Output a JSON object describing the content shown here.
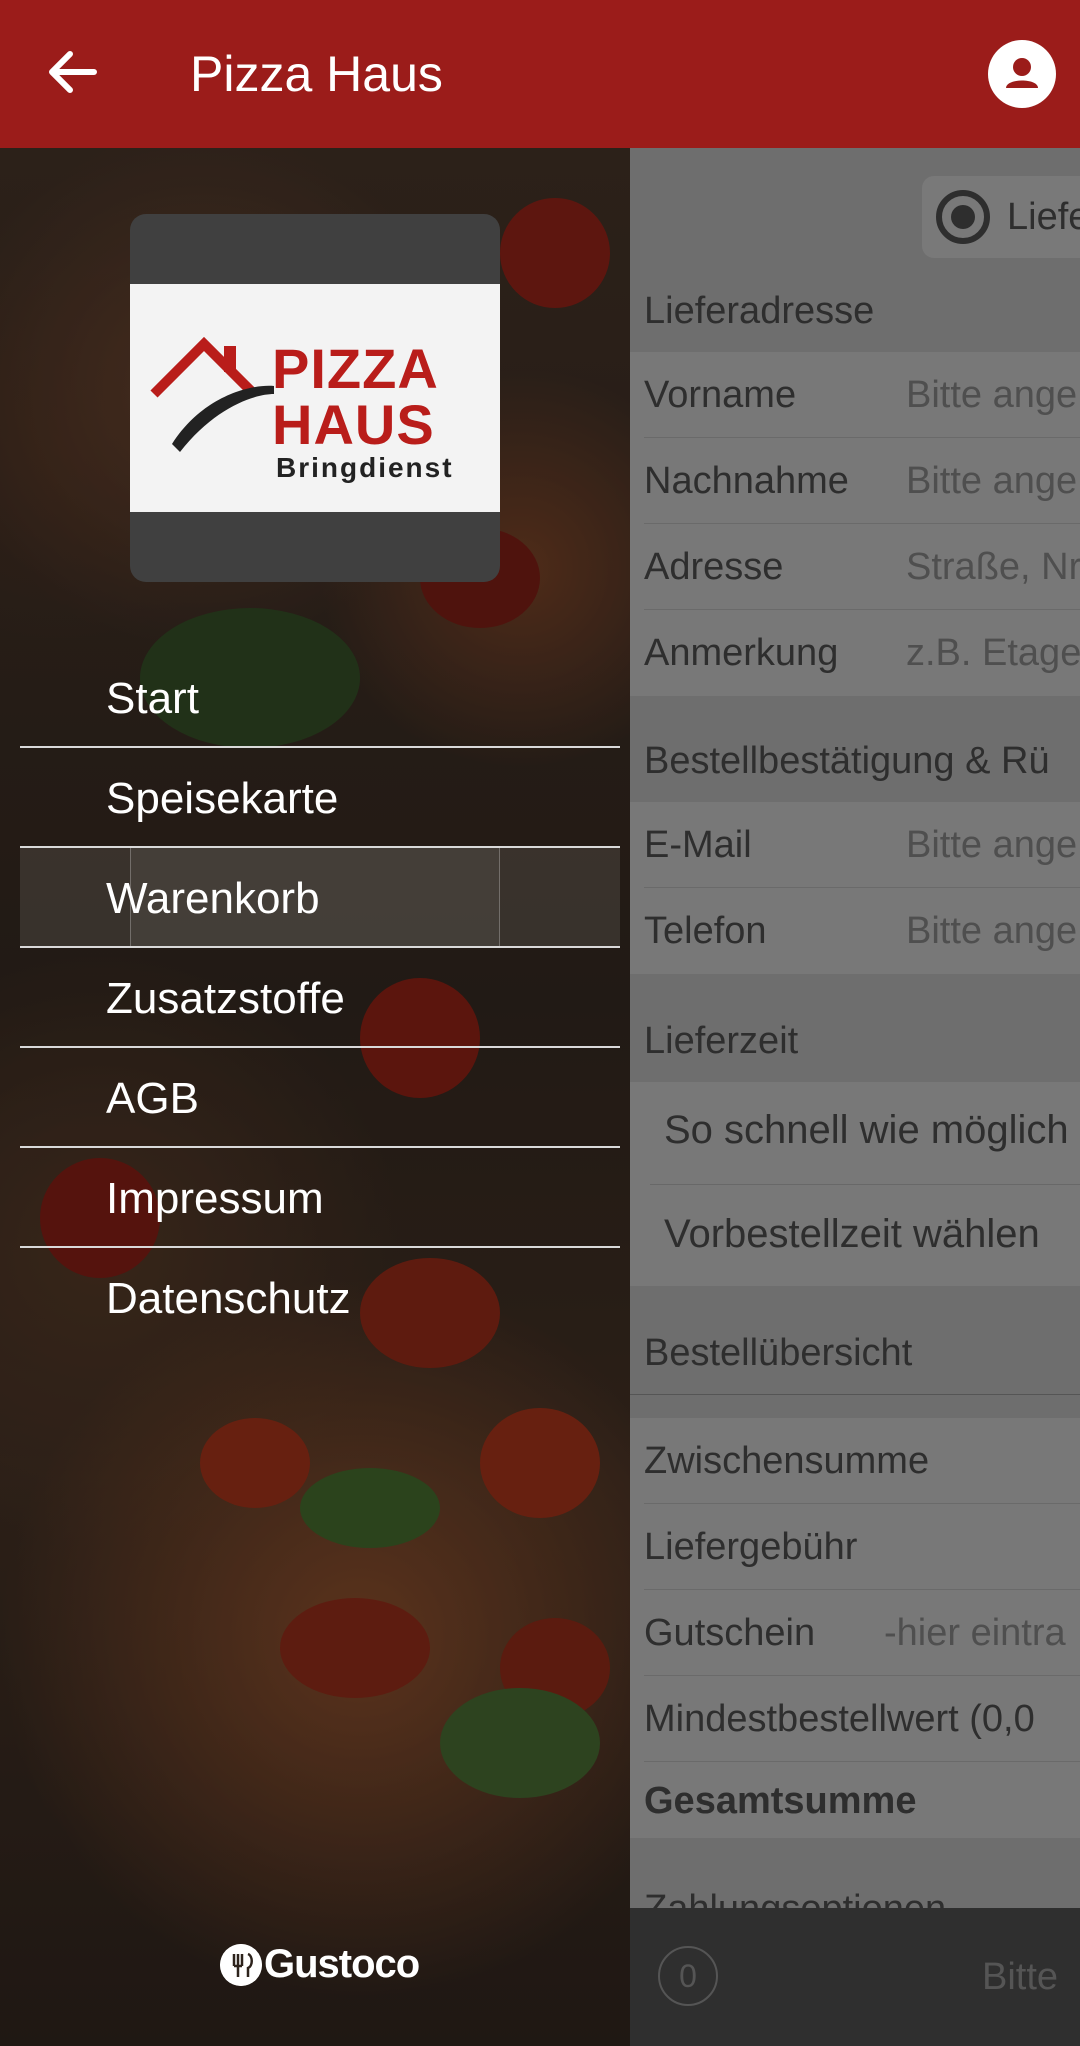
{
  "header": {
    "title": "Pizza Haus",
    "back_icon": "arrow-left-icon",
    "profile_icon": "user-icon",
    "color": "#9b1c1a"
  },
  "drawer": {
    "logo": {
      "line1": "PIZZA",
      "line2": "HAUS",
      "line3": "Bringdienst"
    },
    "items": [
      {
        "label": "Start"
      },
      {
        "label": "Speisekarte"
      },
      {
        "label": "Warenkorb",
        "active": true
      },
      {
        "label": "Zusatzstoffe"
      },
      {
        "label": "AGB"
      },
      {
        "label": "Impressum"
      },
      {
        "label": "Datenschutz"
      }
    ],
    "brand": "Gustoco"
  },
  "background": {
    "radio_label": "Liefe",
    "sections": {
      "delivery_address": "Lieferadresse",
      "confirmation": "Bestellbestätigung & Rü",
      "delivery_time": "Lieferzeit",
      "overview": "Bestellübersicht",
      "payment": "Zahlungsoptionen"
    },
    "address_fields": [
      {
        "label": "Vorname",
        "placeholder": "Bitte ange"
      },
      {
        "label": "Nachnahme",
        "placeholder": "Bitte ange"
      },
      {
        "label": "Adresse",
        "placeholder": "Straße, Nr"
      },
      {
        "label": "Anmerkung",
        "placeholder": "z.B. Etage"
      }
    ],
    "contact_fields": [
      {
        "label": "E-Mail",
        "placeholder": "Bitte ange"
      },
      {
        "label": "Telefon",
        "placeholder": "Bitte ange"
      }
    ],
    "time_options": [
      "So schnell wie möglich",
      "Vorbestellzeit wählen"
    ],
    "overview_rows": {
      "subtotal": "Zwischensumme",
      "delivery_fee": "Liefergebühr",
      "voucher": "Gutschein",
      "voucher_placeholder": "-hier eintra",
      "min_order": "Mindestbestellwert (0,0",
      "total": "Gesamtsumme"
    },
    "bottom": {
      "count": "0",
      "text": "Bitte"
    }
  }
}
